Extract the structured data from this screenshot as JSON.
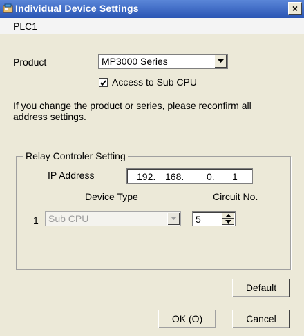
{
  "window": {
    "title": "Individual Device Settings"
  },
  "header": {
    "plc_name": "PLC1"
  },
  "product": {
    "label": "Product",
    "selected": "MP3000 Series",
    "sub_cpu_checkbox_label": "Access to Sub CPU",
    "sub_cpu_checked": true
  },
  "notice": {
    "line1": "If you change the product or series, please reconfirm all",
    "line2": "address settings."
  },
  "relay": {
    "group_title": "Relay Controler Setting",
    "ip_label": "IP Address",
    "ip_octets": [
      "192.",
      "168.",
      "0.",
      "1"
    ],
    "device_type_header": "Device Type",
    "circuit_header": "Circuit No.",
    "row_index": "1",
    "device_type_value": "Sub CPU",
    "circuit_value": "5"
  },
  "buttons": {
    "default": "Default",
    "ok": "OK (O)",
    "cancel": "Cancel"
  }
}
